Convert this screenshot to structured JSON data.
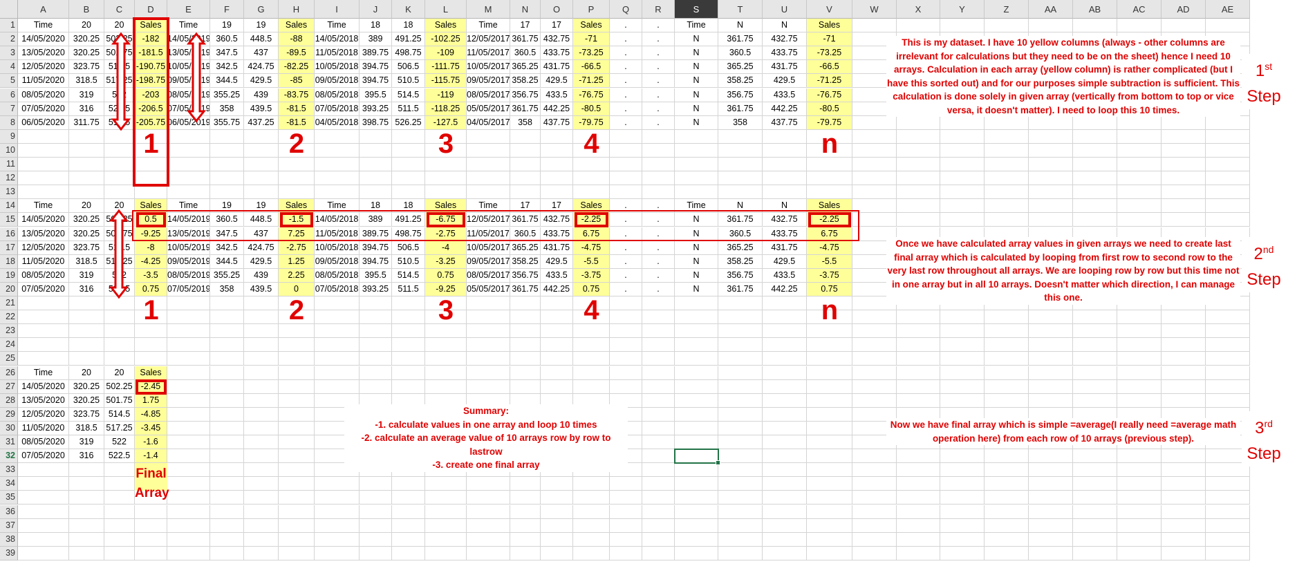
{
  "sheet": {
    "columns": [
      "A",
      "B",
      "C",
      "D",
      "E",
      "F",
      "G",
      "H",
      "I",
      "J",
      "K",
      "L",
      "M",
      "N",
      "O",
      "P",
      "Q",
      "R",
      "S",
      "T",
      "U",
      "V",
      "W",
      "X",
      "Y",
      "Z",
      "AA",
      "AB",
      "AC",
      "AD",
      "AE"
    ],
    "selected_column": "S",
    "selected_row": 32,
    "row_count": 39,
    "yellow_columns": [
      "D",
      "H",
      "L",
      "P",
      "V"
    ],
    "cells": {
      "A1": "Time",
      "B1": "20",
      "C1": "20",
      "D1": "Sales",
      "E1": "Time",
      "F1": "19",
      "G1": "19",
      "H1": "Sales",
      "I1": "Time",
      "J1": "18",
      "K1": "18",
      "L1": "Sales",
      "M1": "Time",
      "N1": "17",
      "O1": "17",
      "P1": "Sales",
      "Q1": ".",
      "R1": ".",
      "S1": "Time",
      "T1": "N",
      "U1": "N",
      "V1": "Sales",
      "A2": "14/05/2020",
      "B2": "320.25",
      "C2": "502.25",
      "D2": "-182",
      "E2": "14/05/2019",
      "F2": "360.5",
      "G2": "448.5",
      "H2": "-88",
      "I2": "14/05/2018",
      "J2": "389",
      "K2": "491.25",
      "L2": "-102.25",
      "M2": "12/05/2017",
      "N2": "361.75",
      "O2": "432.75",
      "P2": "-71",
      "Q2": ".",
      "R2": ".",
      "S2": "N",
      "T2": "361.75",
      "U2": "432.75",
      "V2": "-71",
      "A3": "13/05/2020",
      "B3": "320.25",
      "C3": "501.75",
      "D3": "-181.5",
      "E3": "13/05/2019",
      "F3": "347.5",
      "G3": "437",
      "H3": "-89.5",
      "I3": "11/05/2018",
      "J3": "389.75",
      "K3": "498.75",
      "L3": "-109",
      "M3": "11/05/2017",
      "N3": "360.5",
      "O3": "433.75",
      "P3": "-73.25",
      "Q3": ".",
      "R3": ".",
      "S3": "N",
      "T3": "360.5",
      "U3": "433.75",
      "V3": "-73.25",
      "A4": "12/05/2020",
      "B4": "323.75",
      "C4": "514.5",
      "D4": "-190.75",
      "E4": "10/05/2019",
      "F4": "342.5",
      "G4": "424.75",
      "H4": "-82.25",
      "I4": "10/05/2018",
      "J4": "394.75",
      "K4": "506.5",
      "L4": "-111.75",
      "M4": "10/05/2017",
      "N4": "365.25",
      "O4": "431.75",
      "P4": "-66.5",
      "Q4": ".",
      "R4": ".",
      "S4": "N",
      "T4": "365.25",
      "U4": "431.75",
      "V4": "-66.5",
      "A5": "11/05/2020",
      "B5": "318.5",
      "C5": "517.25",
      "D5": "-198.75",
      "E5": "09/05/2019",
      "F5": "344.5",
      "G5": "429.5",
      "H5": "-85",
      "I5": "09/05/2018",
      "J5": "394.75",
      "K5": "510.5",
      "L5": "-115.75",
      "M5": "09/05/2017",
      "N5": "358.25",
      "O5": "429.5",
      "P5": "-71.25",
      "Q5": ".",
      "R5": ".",
      "S5": "N",
      "T5": "358.25",
      "U5": "429.5",
      "V5": "-71.25",
      "A6": "08/05/2020",
      "B6": "319",
      "C6": "522",
      "D6": "-203",
      "E6": "08/05/2019",
      "F6": "355.25",
      "G6": "439",
      "H6": "-83.75",
      "I6": "08/05/2018",
      "J6": "395.5",
      "K6": "514.5",
      "L6": "-119",
      "M6": "08/05/2017",
      "N6": "356.75",
      "O6": "433.5",
      "P6": "-76.75",
      "Q6": ".",
      "R6": ".",
      "S6": "N",
      "T6": "356.75",
      "U6": "433.5",
      "V6": "-76.75",
      "A7": "07/05/2020",
      "B7": "316",
      "C7": "522.5",
      "D7": "-206.5",
      "E7": "07/05/2019",
      "F7": "358",
      "G7": "439.5",
      "H7": "-81.5",
      "I7": "07/05/2018",
      "J7": "393.25",
      "K7": "511.5",
      "L7": "-118.25",
      "M7": "05/05/2017",
      "N7": "361.75",
      "O7": "442.25",
      "P7": "-80.5",
      "Q7": ".",
      "R7": ".",
      "S7": "N",
      "T7": "361.75",
      "U7": "442.25",
      "V7": "-80.5",
      "A8": "06/05/2020",
      "B8": "311.75",
      "C8": "517.5",
      "D8": "-205.75",
      "E8": "06/05/2019",
      "F8": "355.75",
      "G8": "437.25",
      "H8": "-81.5",
      "I8": "04/05/2018",
      "J8": "398.75",
      "K8": "526.25",
      "L8": "-127.5",
      "M8": "04/05/2017",
      "N8": "358",
      "O8": "437.75",
      "P8": "-79.75",
      "Q8": ".",
      "R8": ".",
      "S8": "N",
      "T8": "358",
      "U8": "437.75",
      "V8": "-79.75",
      "A14": "Time",
      "B14": "20",
      "C14": "20",
      "D14": "Sales",
      "E14": "Time",
      "F14": "19",
      "G14": "19",
      "H14": "Sales",
      "I14": "Time",
      "J14": "18",
      "K14": "18",
      "L14": "Sales",
      "M14": "Time",
      "N14": "17",
      "O14": "17",
      "P14": "Sales",
      "Q14": ".",
      "R14": ".",
      "S14": "Time",
      "T14": "N",
      "U14": "N",
      "V14": "Sales",
      "A15": "14/05/2020",
      "B15": "320.25",
      "C15": "502.25",
      "D15": "0.5",
      "E15": "14/05/2019",
      "F15": "360.5",
      "G15": "448.5",
      "H15": "-1.5",
      "I15": "14/05/2018",
      "J15": "389",
      "K15": "491.25",
      "L15": "-6.75",
      "M15": "12/05/2017",
      "N15": "361.75",
      "O15": "432.75",
      "P15": "-2.25",
      "Q15": ".",
      "R15": ".",
      "S15": "N",
      "T15": "361.75",
      "U15": "432.75",
      "V15": "-2.25",
      "A16": "13/05/2020",
      "B16": "320.25",
      "C16": "501.75",
      "D16": "-9.25",
      "E16": "13/05/2019",
      "F16": "347.5",
      "G16": "437",
      "H16": "7.25",
      "I16": "11/05/2018",
      "J16": "389.75",
      "K16": "498.75",
      "L16": "-2.75",
      "M16": "11/05/2017",
      "N16": "360.5",
      "O16": "433.75",
      "P16": "6.75",
      "Q16": ".",
      "R16": ".",
      "S16": "N",
      "T16": "360.5",
      "U16": "433.75",
      "V16": "6.75",
      "A17": "12/05/2020",
      "B17": "323.75",
      "C17": "514.5",
      "D17": "-8",
      "E17": "10/05/2019",
      "F17": "342.5",
      "G17": "424.75",
      "H17": "-2.75",
      "I17": "10/05/2018",
      "J17": "394.75",
      "K17": "506.5",
      "L17": "-4",
      "M17": "10/05/2017",
      "N17": "365.25",
      "O17": "431.75",
      "P17": "-4.75",
      "Q17": ".",
      "R17": ".",
      "S17": "N",
      "T17": "365.25",
      "U17": "431.75",
      "V17": "-4.75",
      "A18": "11/05/2020",
      "B18": "318.5",
      "C18": "517.25",
      "D18": "-4.25",
      "E18": "09/05/2019",
      "F18": "344.5",
      "G18": "429.5",
      "H18": "1.25",
      "I18": "09/05/2018",
      "J18": "394.75",
      "K18": "510.5",
      "L18": "-3.25",
      "M18": "09/05/2017",
      "N18": "358.25",
      "O18": "429.5",
      "P18": "-5.5",
      "Q18": ".",
      "R18": ".",
      "S18": "N",
      "T18": "358.25",
      "U18": "429.5",
      "V18": "-5.5",
      "A19": "08/05/2020",
      "B19": "319",
      "C19": "522",
      "D19": "-3.5",
      "E19": "08/05/2019",
      "F19": "355.25",
      "G19": "439",
      "H19": "2.25",
      "I19": "08/05/2018",
      "J19": "395.5",
      "K19": "514.5",
      "L19": "0.75",
      "M19": "08/05/2017",
      "N19": "356.75",
      "O19": "433.5",
      "P19": "-3.75",
      "Q19": ".",
      "R19": ".",
      "S19": "N",
      "T19": "356.75",
      "U19": "433.5",
      "V19": "-3.75",
      "A20": "07/05/2020",
      "B20": "316",
      "C20": "522.5",
      "D20": "0.75",
      "E20": "07/05/2019",
      "F20": "358",
      "G20": "439.5",
      "H20": "0",
      "I20": "07/05/2018",
      "J20": "393.25",
      "K20": "511.5",
      "L20": "-9.25",
      "M20": "05/05/2017",
      "N20": "361.75",
      "O20": "442.25",
      "P20": "0.75",
      "Q20": ".",
      "R20": ".",
      "S20": "N",
      "T20": "361.75",
      "U20": "442.25",
      "V20": "0.75",
      "A26": "Time",
      "B26": "20",
      "C26": "20",
      "D26": "Sales",
      "A27": "14/05/2020",
      "B27": "320.25",
      "C27": "502.25",
      "D27": "-2.45",
      "A28": "13/05/2020",
      "B28": "320.25",
      "C28": "501.75",
      "D28": "1.75",
      "A29": "12/05/2020",
      "B29": "323.75",
      "C29": "514.5",
      "D29": "-4.85",
      "A30": "11/05/2020",
      "B30": "318.5",
      "C30": "517.25",
      "D30": "-3.45",
      "A31": "08/05/2020",
      "B31": "319",
      "C31": "522",
      "D31": "-1.6",
      "A32": "07/05/2020",
      "B32": "316",
      "C32": "522.5",
      "D32": "-1.4"
    }
  },
  "annotations": {
    "array_numbers": [
      "1",
      "2",
      "3",
      "4",
      "n"
    ],
    "final_array_label": "Final Array",
    "step1_text": "This is my dataset. I have 10 yellow columns (always - other columns are irrelevant for calculations but they need to be on the sheet) hence I need 10 arrays. Calculation in each array (yellow column) is rather complicated (but I have this sorted out) and for our purposes simple subtraction is sufficient. This calculation is done solely in given array (vertically from bottom to top or vice versa, it doesn't matter). I need to loop this 10 times.",
    "step2_text": "Once we have calculated array values in given arrays we need to create last final array which is calculated by looping from first row to second row  to the very last row throughout all arrays. We are looping row by row but this time not in one array but in all 10 arrays. Doesn't matter which direction, I can manage this one.",
    "step3_text": "Now we have final array which is simple =average(I really need =average math operation here) from each row of 10 arrays (previous step).",
    "summary_title": "Summary:",
    "summary_lines": [
      "-1. calculate values in one array and loop 10 times",
      "-2. calculate an average value of 10 arrays row by row to lastrow",
      "-3. create one final array"
    ],
    "step_labels": [
      {
        "num": "1",
        "sup": "st",
        "word": "Step"
      },
      {
        "num": "2",
        "sup": "nd",
        "word": "Step"
      },
      {
        "num": "3",
        "sup": "rd",
        "word": "Step"
      }
    ]
  },
  "colors": {
    "yellow_fill": "#ffff99",
    "annotation_red": "#e00000",
    "selection_green": "#217346"
  }
}
